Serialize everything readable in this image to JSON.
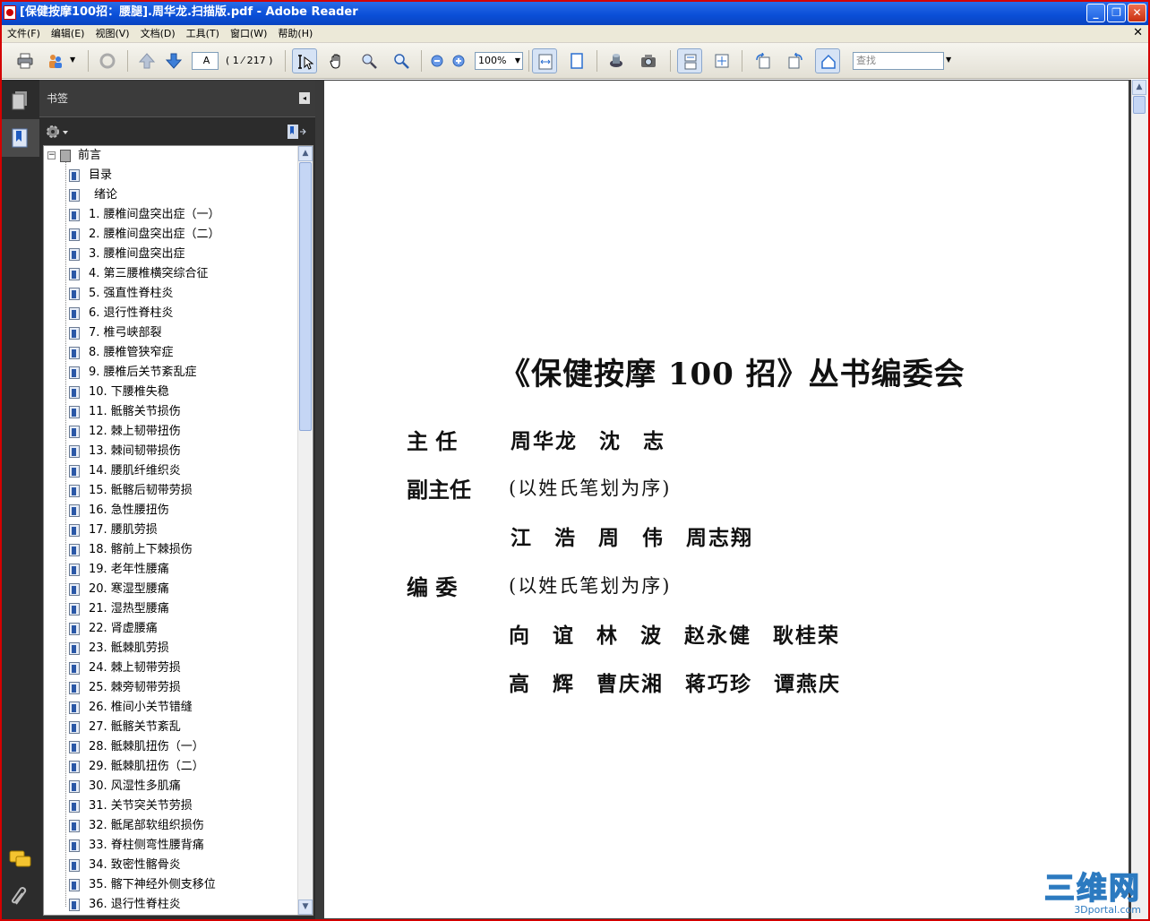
{
  "window": {
    "title": "[保健按摩100招：腰腿].周华龙.扫描版.pdf - Adobe Reader",
    "min": "_",
    "max": "❐",
    "close": "✕"
  },
  "menu": [
    "文件(F)",
    "编辑(E)",
    "视图(V)",
    "文档(D)",
    "工具(T)",
    "窗口(W)",
    "帮助(H)"
  ],
  "menu_close": "✕",
  "toolbar": {
    "page_field": "A",
    "page_count": "( 1 ⁄ 217 )",
    "zoom": "100%",
    "find_placeholder": "查找"
  },
  "panel": {
    "title": "书签",
    "root": "前言"
  },
  "bookmarks": [
    "目录",
    "绪论",
    "1.  腰椎间盘突出症（一）",
    "2.  腰椎间盘突出症（二）",
    "3.  腰椎间盘突出症",
    "4.  第三腰椎横突综合征",
    "5.  强直性脊柱炎",
    "6.  退行性脊柱炎",
    "7.  椎弓峡部裂",
    "8.  腰椎管狭窄症",
    "9.  腰椎后关节紊乱症",
    "10.  下腰椎失稳",
    "11.  骶髂关节损伤",
    "12.  棘上韧带扭伤",
    "13.  棘间韧带损伤",
    "14.  腰肌纤维织炎",
    "15.  骶髂后韧带劳损",
    "16.  急性腰扭伤",
    "17.  腰肌劳损",
    "18.  髂前上下棘损伤",
    "19.  老年性腰痛",
    "20.  寒湿型腰痛",
    "21.  湿热型腰痛",
    "22.  肾虚腰痛",
    "23.  骶棘肌劳损",
    "24.  棘上韧带劳损",
    "25.  棘旁韧带劳损",
    "26.  椎间小关节错缝",
    "27.  骶髂关节紊乱",
    "28.  骶棘肌扭伤（一）",
    "29.  骶棘肌扭伤（二）",
    "30.  风湿性多肌痛",
    "31.  关节突关节劳损",
    "32.  骶尾部软组织损伤",
    "33.  脊柱侧弯性腰背痛",
    "34.  致密性髂骨炎",
    "35.  髂下神经外侧支移位",
    "36.  退行性脊柱炎"
  ],
  "document": {
    "title": "《保健按摩 100 招》丛书编委会",
    "director_label": "主  任",
    "director_names": "周华龙  沈  志",
    "vice_label": "副主任",
    "vice_note": "(以姓氏笔划为序)",
    "vice_names": "江  浩  周  伟  周志翔",
    "editor_label": "编  委",
    "editor_note": "(以姓氏笔划为序)",
    "editor_names_1": "向  谊  林  波  赵永健  耿桂荣",
    "editor_names_2": "高  辉  曹庆湘  蒋巧珍  谭燕庆"
  },
  "watermark": {
    "main": "三维网",
    "sub": "3Dportal.com"
  }
}
